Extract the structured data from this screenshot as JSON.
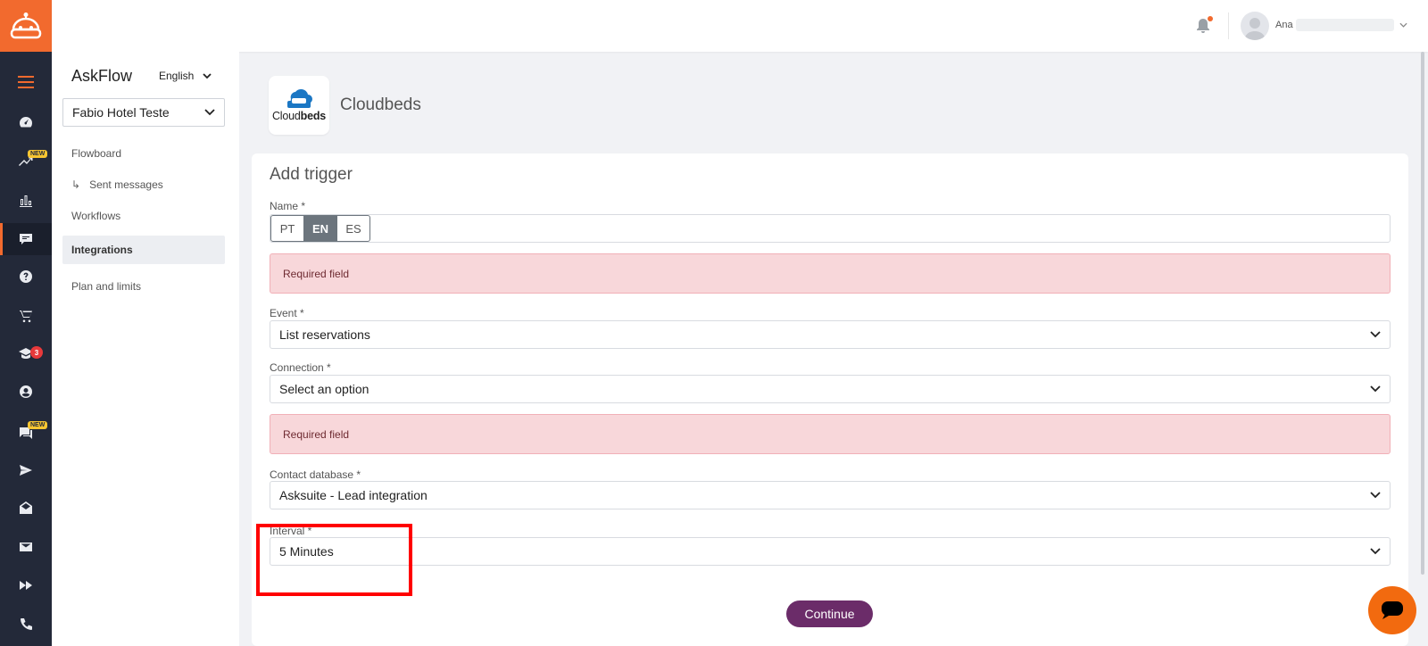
{
  "topbar": {
    "user_name": "Ana"
  },
  "rail": {
    "new_badge": "NEW",
    "academy_count": "3",
    "chat_new_badge": "NEW"
  },
  "sidebar": {
    "title": "AskFlow",
    "language": "English",
    "hotel": "Fabio Hotel Teste",
    "items": [
      {
        "label": "Flowboard"
      },
      {
        "label": "Sent messages"
      },
      {
        "label": "Workflows"
      },
      {
        "label": "Integrations"
      },
      {
        "label": "Plan and limits"
      }
    ]
  },
  "integration": {
    "logo_text_regular": "Cloud",
    "logo_text_bold": "beds",
    "title": "Cloudbeds"
  },
  "form": {
    "title": "Add trigger",
    "name_label": "Name *",
    "lang_tabs": [
      "PT",
      "EN",
      "ES"
    ],
    "active_lang": "EN",
    "name_error": "Required field",
    "event_label": "Event *",
    "event_value": "List reservations",
    "connection_label": "Connection *",
    "connection_value": "Select an option",
    "connection_error": "Required field",
    "contact_db_label": "Contact database *",
    "contact_db_value": "Asksuite - Lead integration",
    "interval_label": "Interval *",
    "interval_value": "5 Minutes",
    "continue_label": "Continue"
  },
  "colors": {
    "brand_orange": "#f26a2e",
    "rail_bg": "#232939",
    "continue_btn": "#6b2c69",
    "error_bg": "#f8d7da",
    "highlight": "#ff0000"
  }
}
